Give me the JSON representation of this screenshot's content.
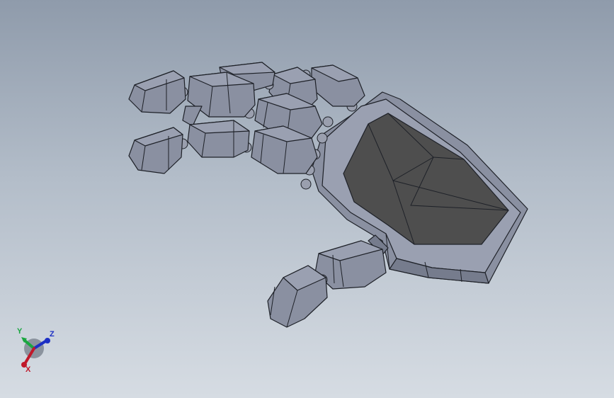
{
  "viewport": {
    "background_top": "#8f9bab",
    "background_bottom": "#d6dce3",
    "model": {
      "description_icon": "robotic-hand-model",
      "body_color": "#8a90a1",
      "palm_cover_color": "#4e4e4e",
      "edge_color": "#1e2128"
    }
  },
  "triad": {
    "x_label": "X",
    "y_label": "Y",
    "z_label": "Z",
    "x_color": "#c0182a",
    "y_color": "#1aa640",
    "z_color": "#1c2fc4"
  }
}
